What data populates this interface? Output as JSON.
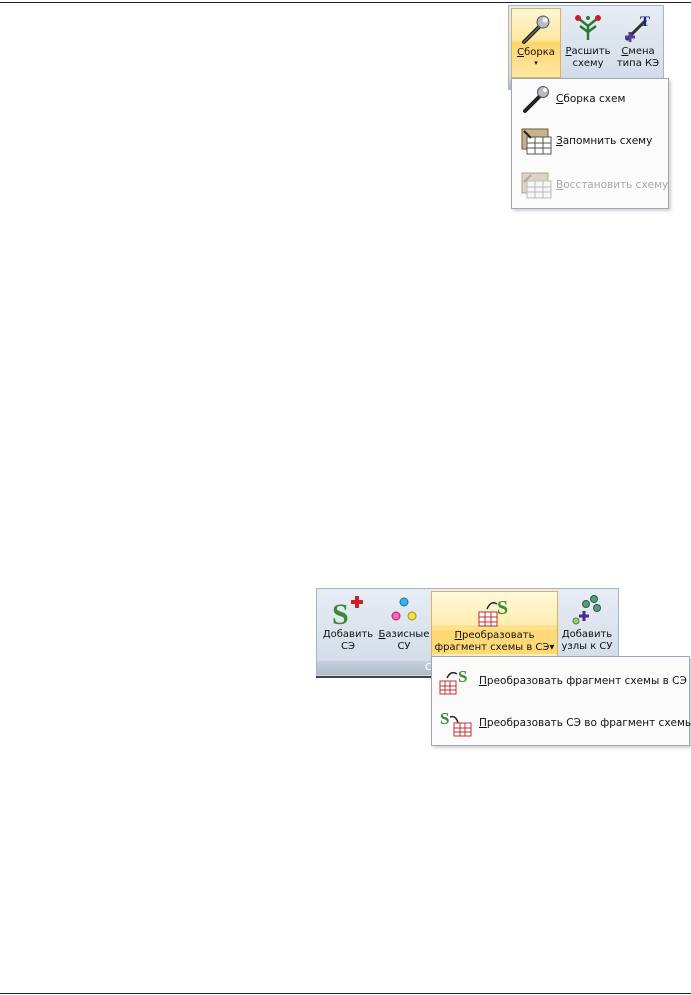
{
  "ribbon_top": {
    "buttons": [
      {
        "label_acc": "С",
        "label_rest": "борка",
        "label_line2": "",
        "icon": "wrench-icon",
        "has_dropdown": true
      },
      {
        "label_acc": "Р",
        "label_rest": "асшить",
        "label_line2": "схему",
        "icon": "unfold-scheme-icon"
      },
      {
        "label_acc": "С",
        "label_rest": "мена",
        "label_line2": "типа КЭ",
        "icon": "change-type-icon"
      }
    ],
    "dropdown_glyph": "▾"
  },
  "menu_top": {
    "items": [
      {
        "acc": "С",
        "rest": "борка схем",
        "icon": "wrench-icon",
        "enabled": true
      },
      {
        "acc": "З",
        "rest": "апомнить схему",
        "icon": "save-scheme-icon",
        "enabled": true
      },
      {
        "acc": "В",
        "rest": "осстановить схему",
        "icon": "restore-scheme-icon",
        "enabled": false
      }
    ]
  },
  "ribbon_bottom": {
    "buttons": [
      {
        "label_acc": "Д",
        "label_rest": "обавить",
        "label_line2": "СЭ",
        "icon": "add-superelement-icon"
      },
      {
        "label_acc": "Б",
        "label_rest": "азисные",
        "label_line2": "СУ",
        "icon": "basis-nodes-icon"
      },
      {
        "label_acc": "П",
        "label_rest": "реобразовать",
        "label_line2": "фрагмент схемы в СЭ",
        "icon": "convert-fragment-icon",
        "has_dropdown": true
      },
      {
        "label_acc": "Д",
        "label_rest": "обавить",
        "label_line2": "узлы к СУ",
        "icon": "add-nodes-icon"
      }
    ],
    "group_label_fragment": "С",
    "dropdown_glyph": "▾"
  },
  "menu_bottom": {
    "items": [
      {
        "acc": "П",
        "rest": "реобразовать фрагмент схемы в СЭ",
        "icon": "convert-fragment-icon"
      },
      {
        "acc": "П",
        "rest": "реобразовать СЭ во фрагмент схемы",
        "icon": "convert-superelement-icon"
      }
    ]
  },
  "colors": {
    "ribbon_bg": "#dbe3ee",
    "hot_bg": "#ffe08a",
    "accent_green": "#3a8a3a",
    "accent_red": "#d02020"
  }
}
